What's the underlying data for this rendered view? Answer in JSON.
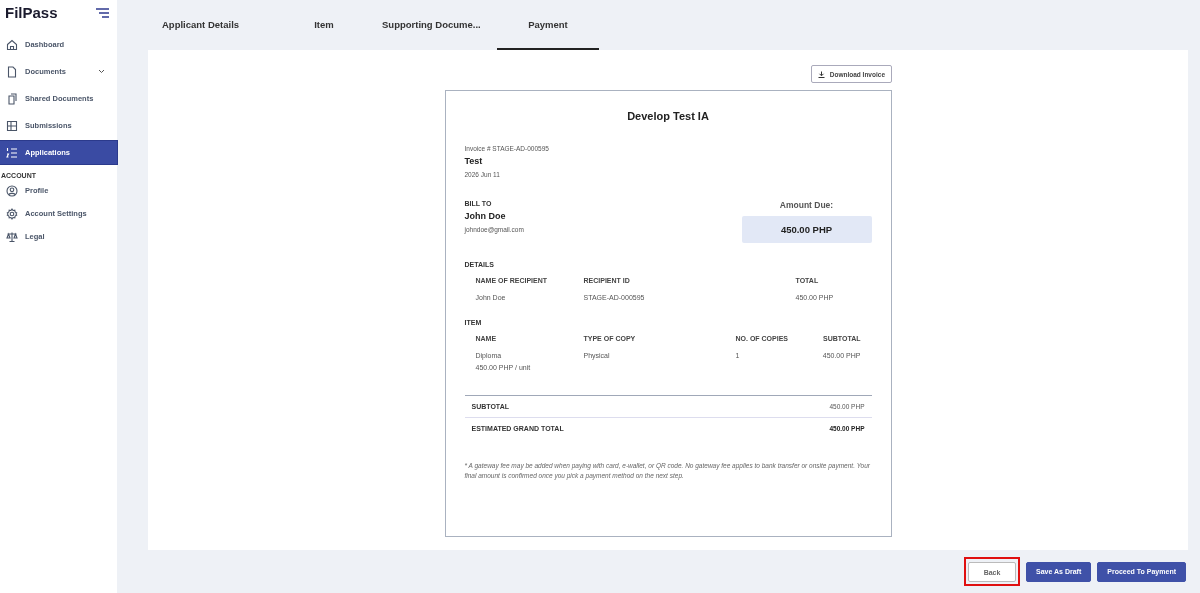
{
  "logo": "FilPass",
  "sidebar": {
    "items": [
      {
        "label": "Dashboard",
        "selected": false,
        "expandable": false
      },
      {
        "label": "Documents",
        "selected": false,
        "expandable": true
      },
      {
        "label": "Shared Documents",
        "selected": false,
        "expandable": false
      },
      {
        "label": "Submissions",
        "selected": false,
        "expandable": false
      },
      {
        "label": "Applications",
        "selected": true,
        "expandable": false
      }
    ],
    "section": "ACCOUNT",
    "account_items": [
      {
        "label": "Profile",
        "selected": false
      },
      {
        "label": "Account Settings",
        "selected": false
      },
      {
        "label": "Legal",
        "selected": false
      }
    ]
  },
  "tabs": [
    {
      "label": "Applicant Details",
      "selected": false
    },
    {
      "label": "Item",
      "selected": false
    },
    {
      "label": "Supporting Docume...",
      "selected": false
    },
    {
      "label": "Payment",
      "selected": true
    }
  ],
  "download_button": "Download Invoice",
  "invoice": {
    "title": "Develop Test IA",
    "number": "Invoice # STAGE-AD-000595",
    "name": "Test",
    "date": "2026 Jun 11",
    "bill_to_label": "BILL TO",
    "bill_name": "John Doe",
    "bill_email": "johndoe@gmail.com",
    "amount_due_label": "Amount Due:",
    "amount_due": "450.00 PHP",
    "details_label": "DETAILS",
    "details_columns": [
      "NAME OF RECIPIENT",
      "RECIPIENT ID",
      "TOTAL"
    ],
    "details_rows": [
      [
        "John Doe",
        "STAGE-AD-000595",
        "450.00 PHP"
      ]
    ],
    "item_label": "ITEM",
    "item_columns": [
      "NAME",
      "TYPE OF COPY",
      "NO. OF COPIES",
      "SUBTOTAL"
    ],
    "item_rows": [
      {
        "name": "Diploma",
        "unit": "450.00 PHP / unit",
        "type": "Physical",
        "copies": "1",
        "subtotal": "450.00 PHP"
      }
    ],
    "subtotal_label": "SUBTOTAL",
    "subtotal": "450.00 PHP",
    "grand_total_label": "ESTIMATED GRAND TOTAL",
    "grand_total": "450.00 PHP",
    "note": "* A gateway fee may be added when paying with card, e-wallet, or QR code. No gateway fee applies to bank transfer or onsite payment. Your final amount is confirmed once you pick a payment method on the next step."
  },
  "buttons": [
    {
      "label": "Back",
      "kind": "outline",
      "highlighted": true
    },
    {
      "label": "Save As Draft",
      "kind": "primary",
      "highlighted": false
    },
    {
      "label": "Proceed To Payment",
      "kind": "primary",
      "highlighted": false
    }
  ]
}
